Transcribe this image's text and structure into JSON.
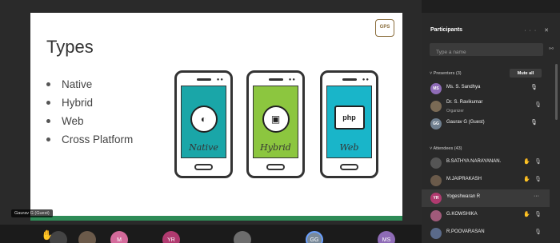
{
  "slide": {
    "title": "Types",
    "bullets": [
      "Native",
      "Hybrid",
      "Web",
      "Cross Platform"
    ],
    "logo_text": "GPS",
    "phones": [
      {
        "label": "Native",
        "emblem": "◐"
      },
      {
        "label": "Hybrid",
        "emblem": "▣"
      },
      {
        "label": "Web",
        "emblem": "php"
      }
    ]
  },
  "presenter_tag": "Gaurav G (Guest)",
  "video_strip": {
    "tiles": [
      {
        "initials": "",
        "color": "#444444"
      },
      {
        "initials": "",
        "color": "#6b5a4a"
      },
      {
        "initials": "M",
        "color": "#d36a9a"
      },
      {
        "initials": "YR",
        "color": "#b03a6f"
      },
      {
        "initials": "",
        "color": "#6d6d6d"
      },
      {
        "initials": "GG",
        "color": "#7a8a9a"
      },
      {
        "initials": "MS",
        "color": "#8e6bb6"
      }
    ]
  },
  "panel": {
    "title": "Participants",
    "search_placeholder": "Type a name",
    "presenters_label": "Presenters (3)",
    "mute_all_label": "Mute all",
    "attendees_label": "Attendees (43)",
    "presenters": [
      {
        "initials": "MS",
        "name": "Ms. S. Sandhya",
        "sub": "",
        "color": "#8e6bb6"
      },
      {
        "initials": "",
        "name": "Dr. S. Ravikumar",
        "sub": "Organizer",
        "color": "#7a6a55"
      },
      {
        "initials": "GG",
        "name": "Gaurav G (Guest)",
        "sub": "",
        "color": "#6f7f8f"
      }
    ],
    "attendees": [
      {
        "initials": "",
        "name": "B.SATHYA NARAYANAN.",
        "color": "#555555"
      },
      {
        "initials": "",
        "name": "M.JAIPRAKASH",
        "color": "#6a5a4a"
      },
      {
        "initials": "YR",
        "name": "Yogeshwaran R",
        "color": "#b03a6f"
      },
      {
        "initials": "",
        "name": "G.KOWSHIKA",
        "color": "#a05a7a"
      },
      {
        "initials": "",
        "name": "R.POOVARASAN",
        "color": "#5a6a8a"
      }
    ]
  }
}
